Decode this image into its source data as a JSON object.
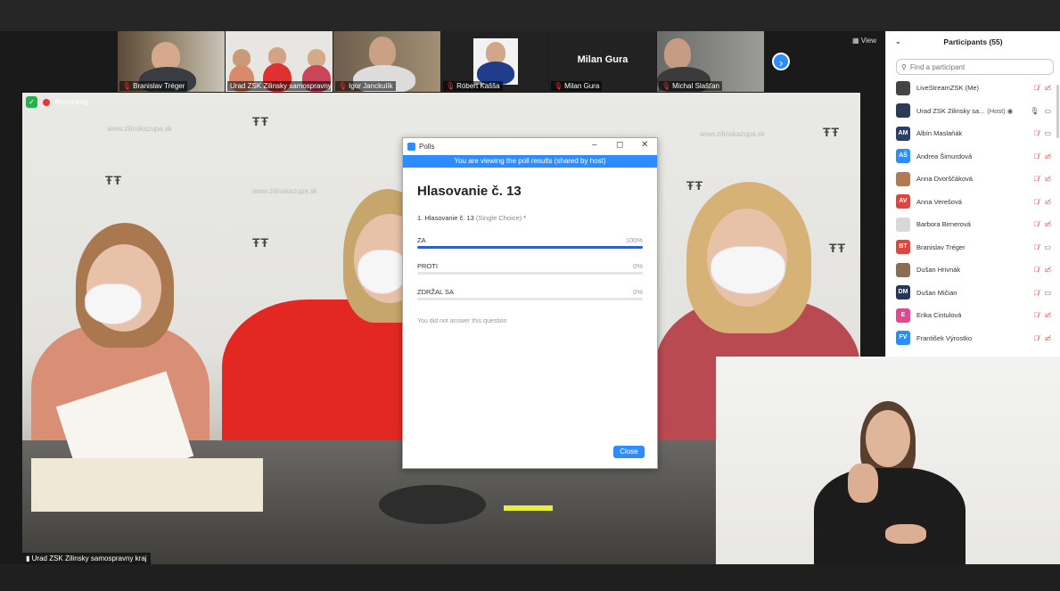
{
  "thumbnails": [
    {
      "name": "Branislav Tréger",
      "muted": true
    },
    {
      "name": "Urad ZSK Zilinsky samospravny",
      "muted": false
    },
    {
      "name": "Igor Janckulík",
      "muted": true
    },
    {
      "name": "Róbert Kašša",
      "muted": true
    },
    {
      "name": "Milan Gura",
      "muted": true,
      "big_label": "Milan Gura"
    },
    {
      "name": "Michal Slašťan",
      "muted": true
    }
  ],
  "view_label": "View",
  "recording_label": "Recording",
  "main_video_name": "Urad ZSK Zilinsky samospravny kraj",
  "wall": {
    "url_text": "www.zilinskazupa.sk",
    "logo_text": "ŽILINSKÝ SAMOSPRÁVNY KRAJ"
  },
  "poll": {
    "window_title": "Polls",
    "banner": "You are viewing the poll results (shared by host)",
    "title": "Hlasovanie č. 13",
    "question": "1. Hlasovanie č. 13",
    "question_type": "(Single Choice)",
    "required_mark": "*",
    "options": [
      {
        "label": "ZA",
        "percent": "100%",
        "fraction": 1.0
      },
      {
        "label": "PROTI",
        "percent": "0%",
        "fraction": 0.0
      },
      {
        "label": "ZDRŽAL SA",
        "percent": "0%",
        "fraction": 0.0
      }
    ],
    "note": "You did not answer this question",
    "close_label": "Close"
  },
  "participants": {
    "title": "Participants (55)",
    "search_placeholder": "Find a participant",
    "list": [
      {
        "initials": "",
        "color": "#444444",
        "name": "LiveStreamZSK (Me)",
        "host": ""
      },
      {
        "initials": "",
        "color": "#2b3a55",
        "name": "Urad ZSK Zilinsky sa...",
        "host": "(Host)"
      },
      {
        "initials": "AM",
        "color": "#2a3f66",
        "name": "Albín Maslaňák",
        "host": ""
      },
      {
        "initials": "AŠ",
        "color": "#2d8cff",
        "name": "Andrea Šimurdová",
        "host": ""
      },
      {
        "initials": "",
        "color": "#b07a55",
        "name": "Anna Dvorščáková",
        "host": ""
      },
      {
        "initials": "AV",
        "color": "#e0443a",
        "name": "Anna Verešová",
        "host": ""
      },
      {
        "initials": "",
        "color": "#d8d8d8",
        "name": "Barbora Birnerová",
        "host": ""
      },
      {
        "initials": "BT",
        "color": "#e0443a",
        "name": "Branislav Tréger",
        "host": ""
      },
      {
        "initials": "",
        "color": "#8a6e52",
        "name": "Dušan Hrivnák",
        "host": ""
      },
      {
        "initials": "DM",
        "color": "#23385c",
        "name": "Dušan Mičian",
        "host": ""
      },
      {
        "initials": "E",
        "color": "#e6468f",
        "name": "Erika Cintulová",
        "host": ""
      },
      {
        "initials": "FV",
        "color": "#2d8cff",
        "name": "František Výrostko",
        "host": ""
      }
    ]
  }
}
